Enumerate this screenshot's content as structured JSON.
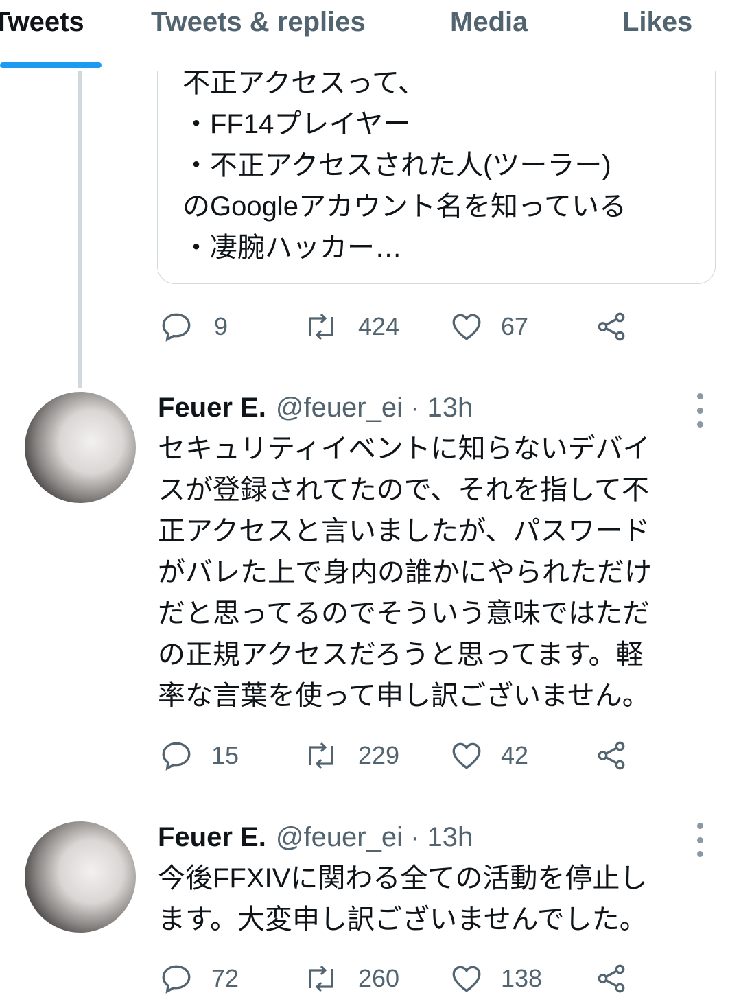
{
  "tabs": [
    {
      "label": "Tweets"
    },
    {
      "label": "Tweets & replies"
    },
    {
      "label": "Media"
    },
    {
      "label": "Likes"
    }
  ],
  "quote": {
    "text": "不正アクセスって、\n・FF14プレイヤー\n・不正アクセスされた人(ツーラー)\nのGoogleアカウント名を知っている\n・凄腕ハッカー…"
  },
  "tweet0_actions": {
    "replies": "9",
    "retweets": "424",
    "likes": "67"
  },
  "tweets": [
    {
      "name": "Feuer E.",
      "handle": "@feuer_ei · 13h",
      "body": "セキュリティイベントに知らないデバイ\nスが登録されてたので、それを指して不\n正アクセスと言いましたが、パスワード\nがバレた上で身内の誰かにやられただけ\nだと思ってるのでそういう意味ではただ\nの正規アクセスだろうと思ってます。軽\n率な言葉を使って申し訳ございません。",
      "replies": "15",
      "retweets": "229",
      "likes": "42"
    },
    {
      "name": "Feuer E.",
      "handle": "@feuer_ei · 13h",
      "body": "今後FFXIVに関わる全ての活動を停止し\nます。大変申し訳ございませんでした。",
      "replies": "72",
      "retweets": "260",
      "likes": "138"
    }
  ],
  "colors": {
    "accent": "#1d9bf0",
    "muted": "#536471",
    "text": "#0f1419"
  }
}
